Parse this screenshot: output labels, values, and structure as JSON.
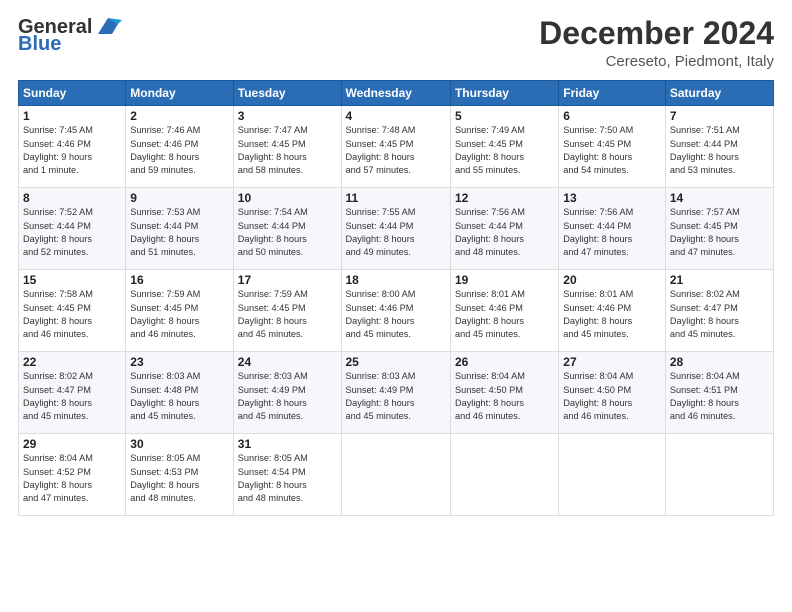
{
  "logo": {
    "line1": "General",
    "line2": "Blue"
  },
  "title": "December 2024",
  "location": "Cereseto, Piedmont, Italy",
  "days_header": [
    "Sunday",
    "Monday",
    "Tuesday",
    "Wednesday",
    "Thursday",
    "Friday",
    "Saturday"
  ],
  "weeks": [
    [
      {
        "day": "1",
        "info": "Sunrise: 7:45 AM\nSunset: 4:46 PM\nDaylight: 9 hours\nand 1 minute."
      },
      {
        "day": "2",
        "info": "Sunrise: 7:46 AM\nSunset: 4:46 PM\nDaylight: 8 hours\nand 59 minutes."
      },
      {
        "day": "3",
        "info": "Sunrise: 7:47 AM\nSunset: 4:45 PM\nDaylight: 8 hours\nand 58 minutes."
      },
      {
        "day": "4",
        "info": "Sunrise: 7:48 AM\nSunset: 4:45 PM\nDaylight: 8 hours\nand 57 minutes."
      },
      {
        "day": "5",
        "info": "Sunrise: 7:49 AM\nSunset: 4:45 PM\nDaylight: 8 hours\nand 55 minutes."
      },
      {
        "day": "6",
        "info": "Sunrise: 7:50 AM\nSunset: 4:45 PM\nDaylight: 8 hours\nand 54 minutes."
      },
      {
        "day": "7",
        "info": "Sunrise: 7:51 AM\nSunset: 4:44 PM\nDaylight: 8 hours\nand 53 minutes."
      }
    ],
    [
      {
        "day": "8",
        "info": "Sunrise: 7:52 AM\nSunset: 4:44 PM\nDaylight: 8 hours\nand 52 minutes."
      },
      {
        "day": "9",
        "info": "Sunrise: 7:53 AM\nSunset: 4:44 PM\nDaylight: 8 hours\nand 51 minutes."
      },
      {
        "day": "10",
        "info": "Sunrise: 7:54 AM\nSunset: 4:44 PM\nDaylight: 8 hours\nand 50 minutes."
      },
      {
        "day": "11",
        "info": "Sunrise: 7:55 AM\nSunset: 4:44 PM\nDaylight: 8 hours\nand 49 minutes."
      },
      {
        "day": "12",
        "info": "Sunrise: 7:56 AM\nSunset: 4:44 PM\nDaylight: 8 hours\nand 48 minutes."
      },
      {
        "day": "13",
        "info": "Sunrise: 7:56 AM\nSunset: 4:44 PM\nDaylight: 8 hours\nand 47 minutes."
      },
      {
        "day": "14",
        "info": "Sunrise: 7:57 AM\nSunset: 4:45 PM\nDaylight: 8 hours\nand 47 minutes."
      }
    ],
    [
      {
        "day": "15",
        "info": "Sunrise: 7:58 AM\nSunset: 4:45 PM\nDaylight: 8 hours\nand 46 minutes."
      },
      {
        "day": "16",
        "info": "Sunrise: 7:59 AM\nSunset: 4:45 PM\nDaylight: 8 hours\nand 46 minutes."
      },
      {
        "day": "17",
        "info": "Sunrise: 7:59 AM\nSunset: 4:45 PM\nDaylight: 8 hours\nand 45 minutes."
      },
      {
        "day": "18",
        "info": "Sunrise: 8:00 AM\nSunset: 4:46 PM\nDaylight: 8 hours\nand 45 minutes."
      },
      {
        "day": "19",
        "info": "Sunrise: 8:01 AM\nSunset: 4:46 PM\nDaylight: 8 hours\nand 45 minutes."
      },
      {
        "day": "20",
        "info": "Sunrise: 8:01 AM\nSunset: 4:46 PM\nDaylight: 8 hours\nand 45 minutes."
      },
      {
        "day": "21",
        "info": "Sunrise: 8:02 AM\nSunset: 4:47 PM\nDaylight: 8 hours\nand 45 minutes."
      }
    ],
    [
      {
        "day": "22",
        "info": "Sunrise: 8:02 AM\nSunset: 4:47 PM\nDaylight: 8 hours\nand 45 minutes."
      },
      {
        "day": "23",
        "info": "Sunrise: 8:03 AM\nSunset: 4:48 PM\nDaylight: 8 hours\nand 45 minutes."
      },
      {
        "day": "24",
        "info": "Sunrise: 8:03 AM\nSunset: 4:49 PM\nDaylight: 8 hours\nand 45 minutes."
      },
      {
        "day": "25",
        "info": "Sunrise: 8:03 AM\nSunset: 4:49 PM\nDaylight: 8 hours\nand 45 minutes."
      },
      {
        "day": "26",
        "info": "Sunrise: 8:04 AM\nSunset: 4:50 PM\nDaylight: 8 hours\nand 46 minutes."
      },
      {
        "day": "27",
        "info": "Sunrise: 8:04 AM\nSunset: 4:50 PM\nDaylight: 8 hours\nand 46 minutes."
      },
      {
        "day": "28",
        "info": "Sunrise: 8:04 AM\nSunset: 4:51 PM\nDaylight: 8 hours\nand 46 minutes."
      }
    ],
    [
      {
        "day": "29",
        "info": "Sunrise: 8:04 AM\nSunset: 4:52 PM\nDaylight: 8 hours\nand 47 minutes."
      },
      {
        "day": "30",
        "info": "Sunrise: 8:05 AM\nSunset: 4:53 PM\nDaylight: 8 hours\nand 48 minutes."
      },
      {
        "day": "31",
        "info": "Sunrise: 8:05 AM\nSunset: 4:54 PM\nDaylight: 8 hours\nand 48 minutes."
      },
      null,
      null,
      null,
      null
    ]
  ]
}
